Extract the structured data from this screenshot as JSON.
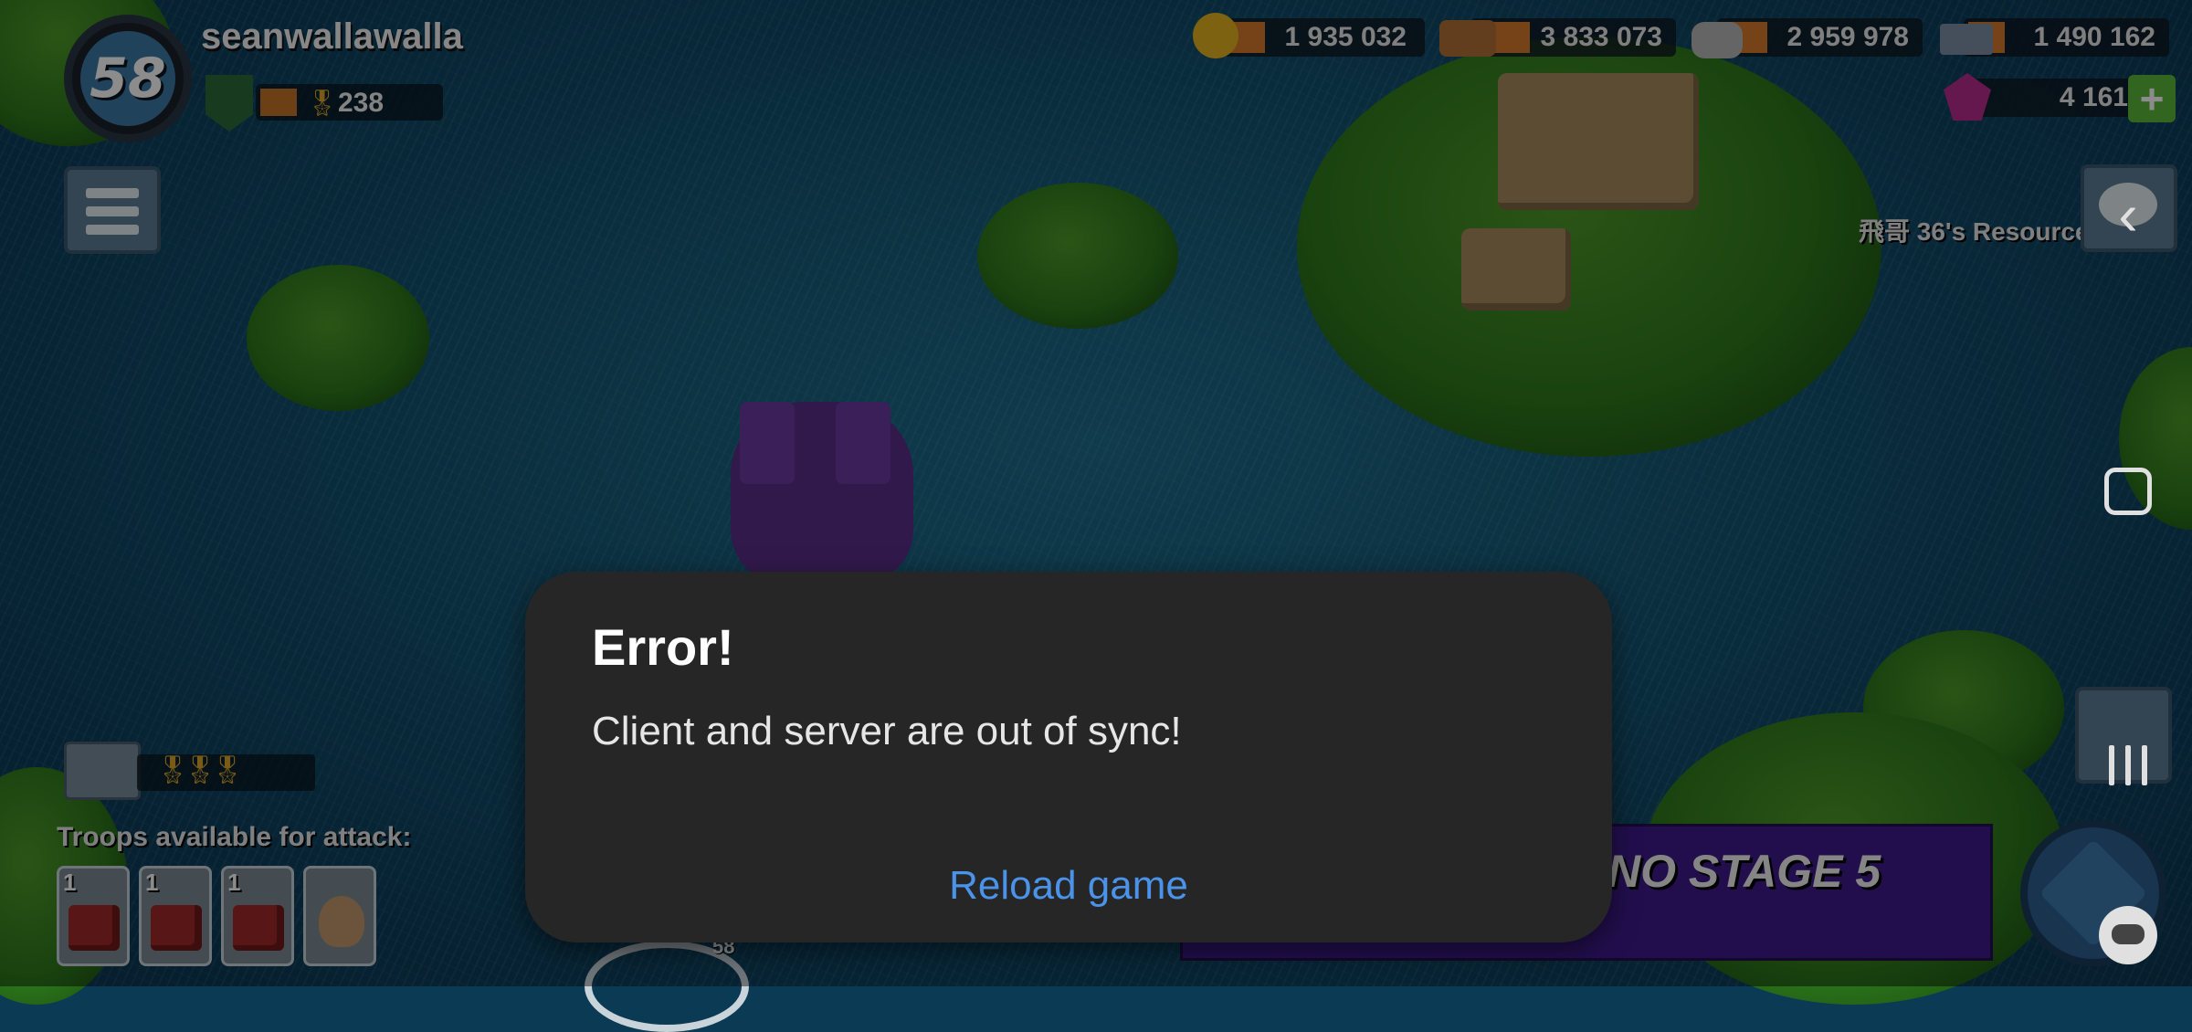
{
  "player": {
    "level": "58",
    "name": "seanwallawalla",
    "medals": "238"
  },
  "resources": {
    "gold": "1 935 032",
    "wood": "3 833 073",
    "stone": "2 959 978",
    "iron": "1 490 162",
    "diamonds": "4 161"
  },
  "map": {
    "resource_base_label": "飛哥 36's Resource",
    "operation_banner": "NO STAGE 5",
    "home_base_level": "58"
  },
  "troops": {
    "label": "Troops available for attack:",
    "cards": [
      {
        "count": "1",
        "type": "tank-icon"
      },
      {
        "count": "1",
        "type": "tank-icon"
      },
      {
        "count": "1",
        "type": "tank-icon"
      },
      {
        "count": "",
        "type": "hero-icon"
      }
    ]
  },
  "dialog": {
    "title": "Error!",
    "message": "Client and server are out of sync!",
    "action_label": "Reload game"
  },
  "colors": {
    "dialog_bg": "#262626",
    "action_blue": "#4a93e8",
    "ocean": "#155a78"
  }
}
